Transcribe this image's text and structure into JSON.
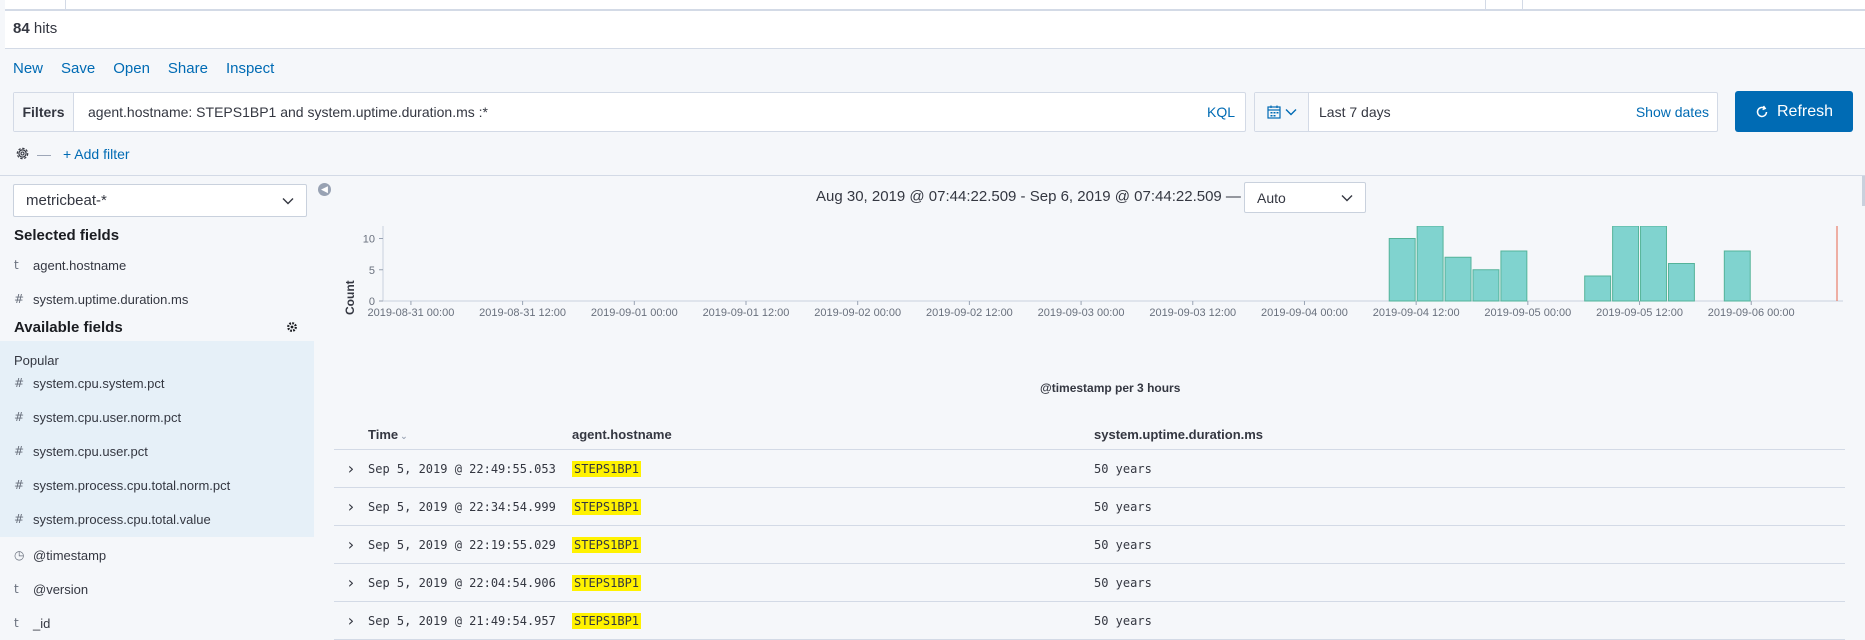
{
  "hits": {
    "count": "84",
    "label": "hits"
  },
  "menu": [
    "New",
    "Save",
    "Open",
    "Share",
    "Inspect"
  ],
  "query": {
    "filters_label": "Filters",
    "text": "agent.hostname: STEPS1BP1 and system.uptime.duration.ms :*",
    "kql": "KQL"
  },
  "date": {
    "range": "Last 7 days",
    "show_dates": "Show dates"
  },
  "refresh_label": "Refresh",
  "add_filter": "+ Add filter",
  "sidebar": {
    "index_pattern": "metricbeat-*",
    "selected_heading": "Selected fields",
    "selected_fields": [
      {
        "type": "t",
        "name": "agent.hostname"
      },
      {
        "type": "#",
        "name": "system.uptime.duration.ms"
      }
    ],
    "available_heading": "Available fields",
    "popular_label": "Popular",
    "popular_fields": [
      {
        "type": "#",
        "name": "system.cpu.system.pct"
      },
      {
        "type": "#",
        "name": "system.cpu.user.norm.pct"
      },
      {
        "type": "#",
        "name": "system.cpu.user.pct"
      },
      {
        "type": "#",
        "name": "system.process.cpu.total.norm.pct"
      },
      {
        "type": "#",
        "name": "system.process.cpu.total.value"
      }
    ],
    "other_fields": [
      {
        "type": "◷",
        "name": "@timestamp"
      },
      {
        "type": "t",
        "name": "@version"
      },
      {
        "type": "t",
        "name": "_id"
      }
    ]
  },
  "timerange": "Aug 30, 2019 @ 07:44:22.509 - Sep 6, 2019 @ 07:44:22.509 —",
  "interval": "Auto",
  "chart_data": {
    "type": "bar",
    "ylabel": "Count",
    "xlabel": "@timestamp per 3 hours",
    "ylim": [
      0,
      12
    ],
    "yticks": [
      0,
      5,
      10
    ],
    "xticks": [
      "2019-08-31 00:00",
      "2019-08-31 12:00",
      "2019-09-01 00:00",
      "2019-09-01 12:00",
      "2019-09-02 00:00",
      "2019-09-02 12:00",
      "2019-09-03 00:00",
      "2019-09-03 12:00",
      "2019-09-04 00:00",
      "2019-09-04 12:00",
      "2019-09-05 00:00",
      "2019-09-05 12:00",
      "2019-09-06 00:00"
    ],
    "x": [
      "2019-09-04 09:00",
      "2019-09-04 12:00",
      "2019-09-04 15:00",
      "2019-09-04 18:00",
      "2019-09-04 21:00",
      "2019-09-05 06:00",
      "2019-09-05 09:00",
      "2019-09-05 12:00",
      "2019-09-05 15:00",
      "2019-09-05 21:00"
    ],
    "values": [
      10,
      12,
      7,
      5,
      8,
      4,
      12,
      12,
      6,
      8
    ],
    "color": "#80d3cf",
    "edge_color": "#54b399",
    "grid": false
  },
  "table": {
    "columns": [
      "Time",
      "agent.hostname",
      "system.uptime.duration.ms"
    ],
    "rows": [
      {
        "time": "Sep 5, 2019 @ 22:49:55.053",
        "host": "STEPS1BP1",
        "uptime": "50 years"
      },
      {
        "time": "Sep 5, 2019 @ 22:34:54.999",
        "host": "STEPS1BP1",
        "uptime": "50 years"
      },
      {
        "time": "Sep 5, 2019 @ 22:19:55.029",
        "host": "STEPS1BP1",
        "uptime": "50 years"
      },
      {
        "time": "Sep 5, 2019 @ 22:04:54.906",
        "host": "STEPS1BP1",
        "uptime": "50 years"
      },
      {
        "time": "Sep 5, 2019 @ 21:49:54.957",
        "host": "STEPS1BP1",
        "uptime": "50 years"
      }
    ]
  }
}
